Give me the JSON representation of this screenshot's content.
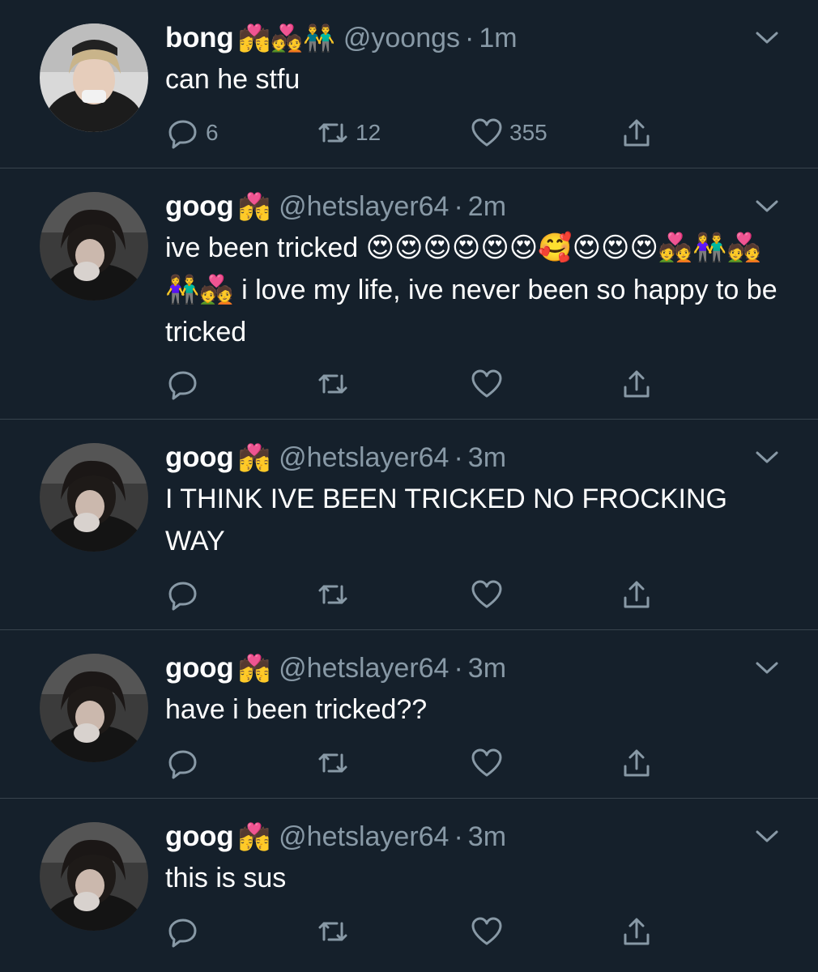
{
  "tweets": [
    {
      "name": "bong",
      "emojis": "💏💑👬",
      "handle": "@yoongs",
      "separator": "·",
      "time": "1m",
      "text": "can he stfu",
      "replies": "6",
      "retweets": "12",
      "likes": "355"
    },
    {
      "name": "goog",
      "emojis": "💏",
      "handle": "@hetslayer64",
      "separator": "·",
      "time": "2m",
      "text": "ive been tricked 😍😍😍😍😍😍🥰😍😍😍💑👫💑👫💑 i love my life, ive never been so happy to be tricked",
      "replies": "",
      "retweets": "",
      "likes": ""
    },
    {
      "name": "goog",
      "emojis": "💏",
      "handle": "@hetslayer64",
      "separator": "·",
      "time": "3m",
      "text": "I THINK IVE BEEN TRICKED NO FROCKING WAY",
      "replies": "",
      "retweets": "",
      "likes": ""
    },
    {
      "name": "goog",
      "emojis": "💏",
      "handle": "@hetslayer64",
      "separator": "·",
      "time": "3m",
      "text": "have i been tricked??",
      "replies": "",
      "retweets": "",
      "likes": ""
    },
    {
      "name": "goog",
      "emojis": "💏",
      "handle": "@hetslayer64",
      "separator": "·",
      "time": "3m",
      "text": "this is sus",
      "replies": "",
      "retweets": "",
      "likes": ""
    }
  ],
  "icons": {
    "reply": "reply-icon",
    "retweet": "retweet-icon",
    "like": "heart-icon",
    "share": "share-icon",
    "more": "chevron-down-icon"
  },
  "colors": {
    "background": "#15202b",
    "secondary_text": "#8899a6",
    "divider": "#38444d"
  }
}
